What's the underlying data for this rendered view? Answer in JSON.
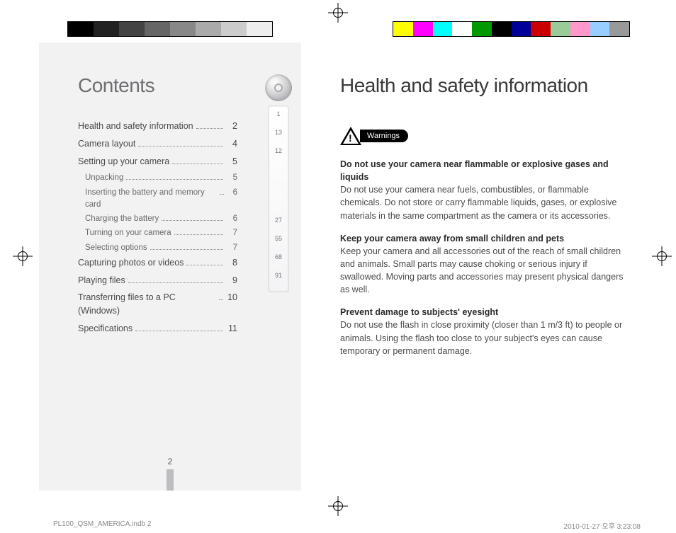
{
  "left": {
    "title": "Contents",
    "toc": [
      {
        "label": "Health and safety information",
        "page": "2",
        "sub": []
      },
      {
        "label": "Camera layout",
        "page": "4",
        "sub": []
      },
      {
        "label": "Setting up your camera",
        "page": "5",
        "sub": [
          {
            "label": "Unpacking",
            "page": "5"
          },
          {
            "label": "Inserting the battery and memory card",
            "page": "6"
          },
          {
            "label": "Charging the battery",
            "page": "6"
          },
          {
            "label": "Turning on your camera",
            "page": "7"
          },
          {
            "label": "Selecting options",
            "page": "7"
          }
        ]
      },
      {
        "label": "Capturing photos or videos",
        "page": "8",
        "sub": []
      },
      {
        "label": "Playing files",
        "page": "9",
        "sub": []
      },
      {
        "label": "Transferring files to a PC (Windows)",
        "page": "10",
        "sub": []
      },
      {
        "label": "Specifications",
        "page": "11",
        "sub": []
      }
    ],
    "ticks": [
      "1",
      "13",
      "12",
      "",
      "27",
      "55",
      "68",
      "91"
    ],
    "page_number": "2"
  },
  "right": {
    "title": "Health and safety information",
    "warnings_label": "Warnings",
    "sections": [
      {
        "heading": "Do not use your camera near flammable or explosive gases and liquids",
        "body": "Do not use your camera near fuels, combustibles, or flammable chemicals. Do not store or carry flammable liquids, gases, or explosive materials in the same compartment as the camera or its accessories."
      },
      {
        "heading": "Keep your camera away from small children and pets",
        "body": "Keep your camera and all accessories out of the reach of small children and animals. Small parts may cause choking or serious injury if swallowed. Moving parts and accessories may present physical dangers as well."
      },
      {
        "heading": "Prevent damage to subjects' eyesight",
        "body": "Do not use the flash in close proximity (closer than 1 m/3 ft) to people or animals. Using the flash too close to your subject's eyes can cause temporary or permanent damage."
      }
    ]
  },
  "footer": {
    "file": "PL100_QSM_AMERICA.indb   2",
    "timestamp": "2010-01-27   오후 3:23:08"
  }
}
